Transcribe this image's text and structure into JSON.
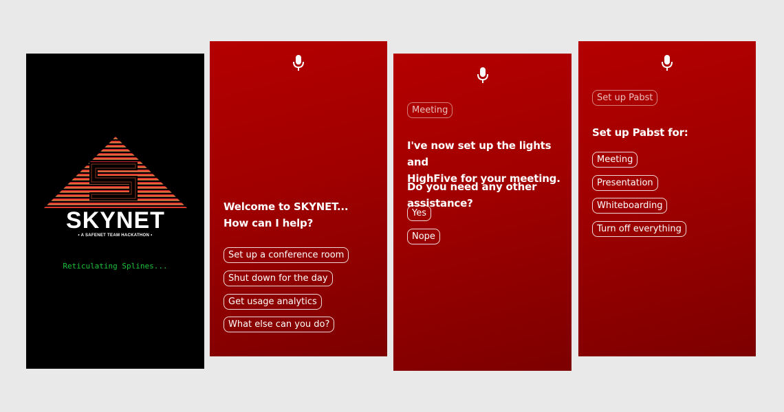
{
  "splash": {
    "logo_text": "SKYNET",
    "tagline": "• A SAFENET TEAM HACKATHON •",
    "loading_text": "Reticulating Splines..."
  },
  "welcome": {
    "mic_icon": "microphone-icon",
    "heading_line1": "Welcome to SKYNET...",
    "heading_line2": "How can I help?",
    "options": [
      "Set up a conference room",
      "Shut down for the day",
      "Get usage analytics",
      "What else can you do?"
    ]
  },
  "meeting": {
    "mic_icon": "microphone-icon",
    "context_chip": "Meeting",
    "message_line1": "I've now set up the lights and",
    "message_line2": "HighFive for your meeting.",
    "question": "Do you need any other assistance?",
    "options": [
      "Yes",
      "Nope"
    ]
  },
  "pabst": {
    "mic_icon": "microphone-icon",
    "context_chip": "Set up Pabst",
    "heading": "Set up Pabst for:",
    "options": [
      "Meeting",
      "Presentation",
      "Whiteboarding",
      "Turn off everything"
    ]
  },
  "colors": {
    "background": "#e9e9e9",
    "red_top": "#b40000",
    "red_bottom": "#7d0000",
    "splash_bg": "#000000",
    "loading_green": "#19c23a",
    "logo_orange": "#f08a3c"
  }
}
